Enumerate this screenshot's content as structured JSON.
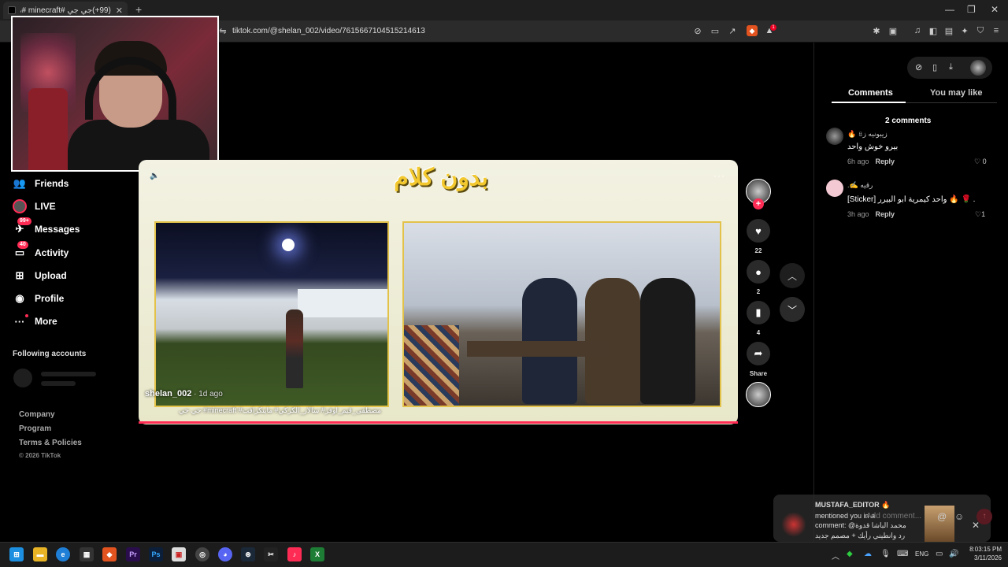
{
  "browser": {
    "tab_title": "(99+)جي جي #minecraft #ماينكرا...",
    "new_tab_icon": "plus-icon",
    "url": "tiktok.com/@shelan_002/video/7615667104515214613",
    "window_controls": [
      "—",
      "❐",
      "✕"
    ],
    "brave_badge": "1"
  },
  "sidebar": {
    "items": [
      {
        "label": "Friends",
        "icon": "friends-icon"
      },
      {
        "label": "LIVE",
        "icon": "live-icon"
      },
      {
        "label": "Messages",
        "icon": "messages-icon",
        "badge": "99+"
      },
      {
        "label": "Activity",
        "icon": "activity-icon",
        "badge": "40"
      },
      {
        "label": "Upload",
        "icon": "upload-icon"
      },
      {
        "label": "Profile",
        "icon": "profile-icon"
      },
      {
        "label": "More",
        "icon": "more-icon"
      }
    ],
    "following_title": "Following accounts",
    "footer": {
      "company": "Company",
      "program": "Program",
      "terms": "Terms & Policies",
      "copyright": "© 2026 TikTok"
    }
  },
  "video": {
    "overlay_title": "بدون كلام",
    "author": "shelan_002",
    "age": " · 1d ago",
    "caption": "مصطفى_قيم_اوفر# سالار_الكركي# ماينكرافت# minecraft# جي جي",
    "more": "···"
  },
  "actions": {
    "likes": "22",
    "comments": "2",
    "saves": "4",
    "share": "Share"
  },
  "panel": {
    "tabs": {
      "comments": "Comments",
      "you_may_like": "You may like"
    },
    "comments_count": "2 comments",
    "comments": [
      {
        "user": "ﺯﻳﺒﻮﻧﻴﻪ ﺯ৪ 🔥",
        "text": "بيرو خوش واحد",
        "age": "6h ago",
        "reply": "Reply",
        "likes": "0"
      },
      {
        "user": "رقيه ✍️.",
        "text": "[Sticker] واحد كيمرية ابو البيرر 🔥 🌹 .",
        "age": "3h ago",
        "reply": "Reply",
        "likes": "1"
      }
    ]
  },
  "toast": {
    "user": "MUSTAFA_EDITOR 🔥",
    "line1": "mentioned you in a",
    "line2": "comment: @محمد الباشا قدوة",
    "line3": "رد وانطيني رأيك + مصمم جديد",
    "placeholder": "Add comment..."
  },
  "taskbar": {
    "lang": "ENG",
    "time": "8:03:15 PM",
    "date": "3/11/2026"
  }
}
